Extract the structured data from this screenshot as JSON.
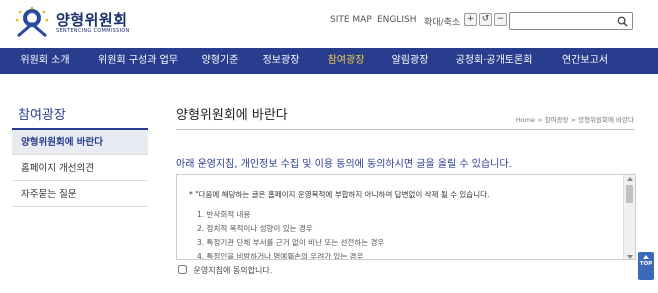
{
  "header": {
    "logo_title": "양형위원회",
    "logo_subtitle": "SENTENCING COMMISSION",
    "site_map": "SITE MAP",
    "english": "ENGLISH",
    "zoom_label": "확대/축소",
    "zoom_in": "+",
    "zoom_reset": "↺",
    "zoom_out": "−",
    "search_placeholder": ""
  },
  "nav": {
    "items": [
      {
        "label": "위원회 소개"
      },
      {
        "label": "위원회 구성과 업무"
      },
      {
        "label": "양형기준"
      },
      {
        "label": "정보광장"
      },
      {
        "label": "참여광장",
        "active": true
      },
      {
        "label": "알림광장"
      },
      {
        "label": "공청회·공개토론회"
      },
      {
        "label": "연간보고서"
      }
    ],
    "active_color": "#f2c94c",
    "bg_color": "#283d8e"
  },
  "lnb": {
    "title": "참여광장",
    "items": [
      {
        "label": "양형위원회에 바란다",
        "active": true
      },
      {
        "label": "홈페이지 개선의견"
      },
      {
        "label": "자주묻는 질문"
      }
    ]
  },
  "content": {
    "page_title": "양형위원회에 바란다",
    "breadcrumb": "Home > 참여광장 > 양형위원회에 바란다",
    "notice": "아래 운영지침, 개인정보 수집 및 이용 동의에 동의하시면 글을 올릴 수 있습니다.",
    "terms": {
      "intro": "* \"다음에 해당하는 글은 홈페이지 운영목적에 부합하지 아니하여 답변없이 삭제 될 수 있습니다.",
      "items": [
        "1. 반사회적 내용",
        "2. 정치적 목적이나 성향이 있는 경우",
        "3. 특정기관 단체 부서를 근거 없이 비난 또는 선전하는 경우",
        "4. 특정인을 비방하거나 명예훼손의 우려가 있는 경우"
      ]
    },
    "agree_label": "운영지침에 동의합니다.",
    "agree_checked": false
  },
  "top_button": "TOP"
}
